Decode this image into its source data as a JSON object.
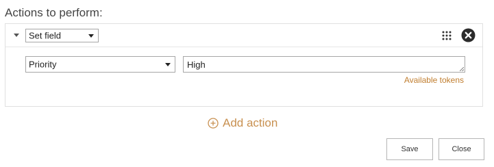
{
  "heading": "Actions to perform:",
  "action": {
    "type_select_value": "Set field",
    "field_select_value": "Priority",
    "value_text": "High",
    "available_tokens_label": "Available tokens"
  },
  "icons": {
    "collapse": "caret-down-icon",
    "drag": "drag-grid-icon",
    "remove": "close-circle-icon",
    "add": "plus-circle-icon"
  },
  "add_action_label": "Add action",
  "buttons": {
    "save": "Save",
    "close": "Close"
  },
  "colors": {
    "accent": "#c07d2e",
    "add_action": "#c89050"
  }
}
